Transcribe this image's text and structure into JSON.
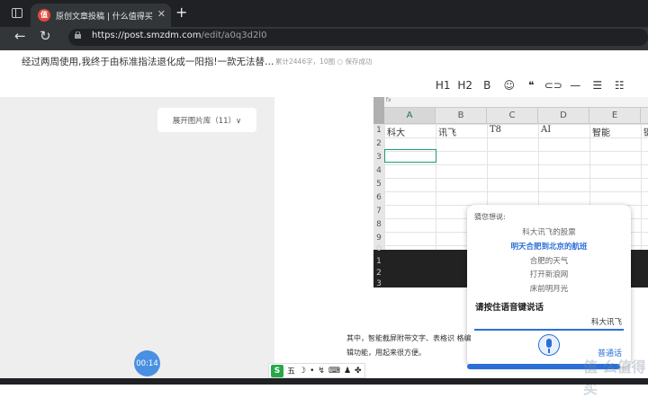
{
  "browser": {
    "tab_title": "原创文章投稿 | 什么值得买",
    "favicon_text": "值",
    "url_host": "https://post.smzdm.com",
    "url_path": "/edit/a0q3d2l0"
  },
  "article": {
    "title": "经过两周使用,我终于由标准指法退化成一阳指!一款无法替…",
    "meta": "累计2446字，10图 ○ 保存成功"
  },
  "left": {
    "gallery_label": "展开图片库（11）∨",
    "timer": "00:14"
  },
  "editor_toolbar": [
    "H1",
    "H2",
    "B",
    "☺",
    "❝",
    "⊂⊃",
    "—",
    "☰",
    "☷"
  ],
  "sheet": {
    "columns": [
      "A",
      "B",
      "C",
      "D",
      "E"
    ],
    "row1": [
      "科大",
      "讯飞",
      "T8",
      "AI",
      "智能",
      "键"
    ],
    "row_numbers": [
      "1",
      "2",
      "3",
      "4",
      "5",
      "6",
      "7",
      "8",
      "9",
      "0",
      "1",
      "2",
      "3"
    ]
  },
  "voice": {
    "hint": "猜您想说:",
    "suggestions": [
      "科大讯飞的股票",
      "明天合肥到北京的航班",
      "合肥的天气",
      "打开新浪网",
      "床前明月光"
    ],
    "press_label": "请按住语音键说话",
    "brand": "科大讯飞",
    "mode": "普通话"
  },
  "body_text": "其中，智能截屏附带文字、表格识 格编辑功能，用起来很方便。",
  "ime": {
    "logo": "S",
    "items": [
      "五",
      "☽",
      "•",
      "↯",
      "⌨",
      "♟",
      "✤"
    ]
  },
  "watermark": "值 么值得买"
}
